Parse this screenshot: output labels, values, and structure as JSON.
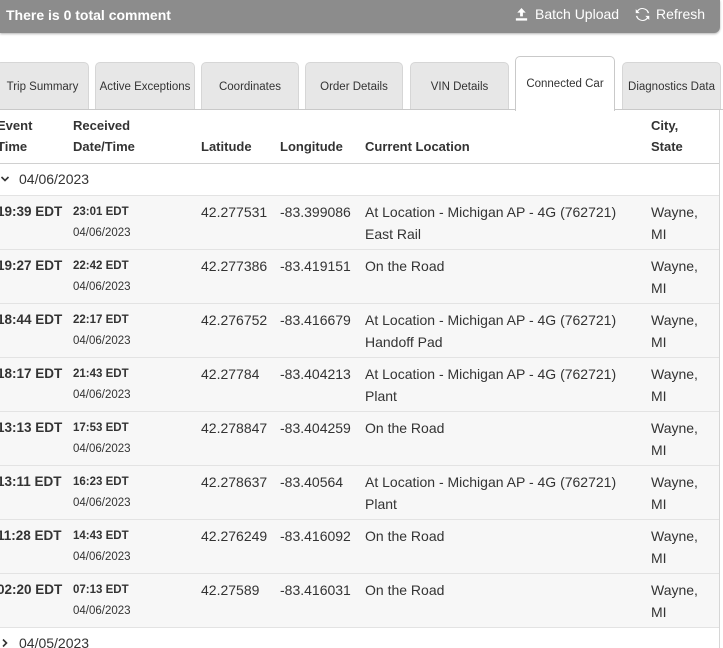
{
  "header": {
    "comment_count": "There is 0 total comment",
    "batch_upload": "Batch Upload",
    "refresh": "Refresh"
  },
  "tabs": [
    {
      "label": "Trip Summary"
    },
    {
      "label": "Active Exceptions"
    },
    {
      "label": "Coordinates"
    },
    {
      "label": "Order Details"
    },
    {
      "label": "VIN Details"
    },
    {
      "label": "Connected Car",
      "active": true
    },
    {
      "label": "Diagnostics Data"
    }
  ],
  "table": {
    "columns": {
      "event_line1": "Event",
      "event_line2": "Time",
      "received_line1": "Received",
      "received_line2": "Date/Time",
      "latitude": "Latitude",
      "longitude": "Longitude",
      "current_location": "Current Location",
      "city_line1": "City,",
      "city_line2": "State"
    },
    "groups": [
      {
        "date": "04/06/2023",
        "expanded": true
      },
      {
        "date": "04/05/2023",
        "expanded": false
      }
    ],
    "rows": [
      {
        "event": "19:39 EDT",
        "recv_time": "23:01 EDT",
        "recv_date": "04/06/2023",
        "lat": "42.277531",
        "lon": "-83.399086",
        "loc1": "At Location - Michigan AP - 4G (762721)",
        "loc2": "East Rail",
        "city1": "Wayne,",
        "city2": "MI"
      },
      {
        "event": "19:27 EDT",
        "recv_time": "22:42 EDT",
        "recv_date": "04/06/2023",
        "lat": "42.277386",
        "lon": "-83.419151",
        "loc1": "On the Road",
        "loc2": "",
        "city1": "Wayne,",
        "city2": "MI"
      },
      {
        "event": "18:44 EDT",
        "recv_time": "22:17 EDT",
        "recv_date": "04/06/2023",
        "lat": "42.276752",
        "lon": "-83.416679",
        "loc1": "At Location - Michigan AP - 4G (762721)",
        "loc2": "Handoff Pad",
        "city1": "Wayne,",
        "city2": "MI"
      },
      {
        "event": "18:17 EDT",
        "recv_time": "21:43 EDT",
        "recv_date": "04/06/2023",
        "lat": "42.27784",
        "lon": "-83.404213",
        "loc1": "At Location - Michigan AP - 4G (762721)",
        "loc2": "Plant",
        "city1": "Wayne,",
        "city2": "MI"
      },
      {
        "event": "13:13 EDT",
        "recv_time": "17:53 EDT",
        "recv_date": "04/06/2023",
        "lat": "42.278847",
        "lon": "-83.404259",
        "loc1": "On the Road",
        "loc2": "",
        "city1": "Wayne,",
        "city2": "MI"
      },
      {
        "event": "13:11 EDT",
        "recv_time": "16:23 EDT",
        "recv_date": "04/06/2023",
        "lat": "42.278637",
        "lon": "-83.40564",
        "loc1": "At Location - Michigan AP - 4G (762721)",
        "loc2": "Plant",
        "city1": "Wayne,",
        "city2": "MI"
      },
      {
        "event": "11:28 EDT",
        "recv_time": "14:43 EDT",
        "recv_date": "04/06/2023",
        "lat": "42.276249",
        "lon": "-83.416092",
        "loc1": "On the Road",
        "loc2": "",
        "city1": "Wayne,",
        "city2": "MI"
      },
      {
        "event": "02:20 EDT",
        "recv_time": "07:13 EDT",
        "recv_date": "04/06/2023",
        "lat": "42.27589",
        "lon": "-83.416031",
        "loc1": "On the Road",
        "loc2": "",
        "city1": "Wayne,",
        "city2": "MI"
      }
    ]
  },
  "icons": {
    "upload": "upload-icon",
    "refresh": "refresh-icon",
    "expanded": "chevron-down-icon",
    "collapsed": "chevron-right-icon"
  }
}
